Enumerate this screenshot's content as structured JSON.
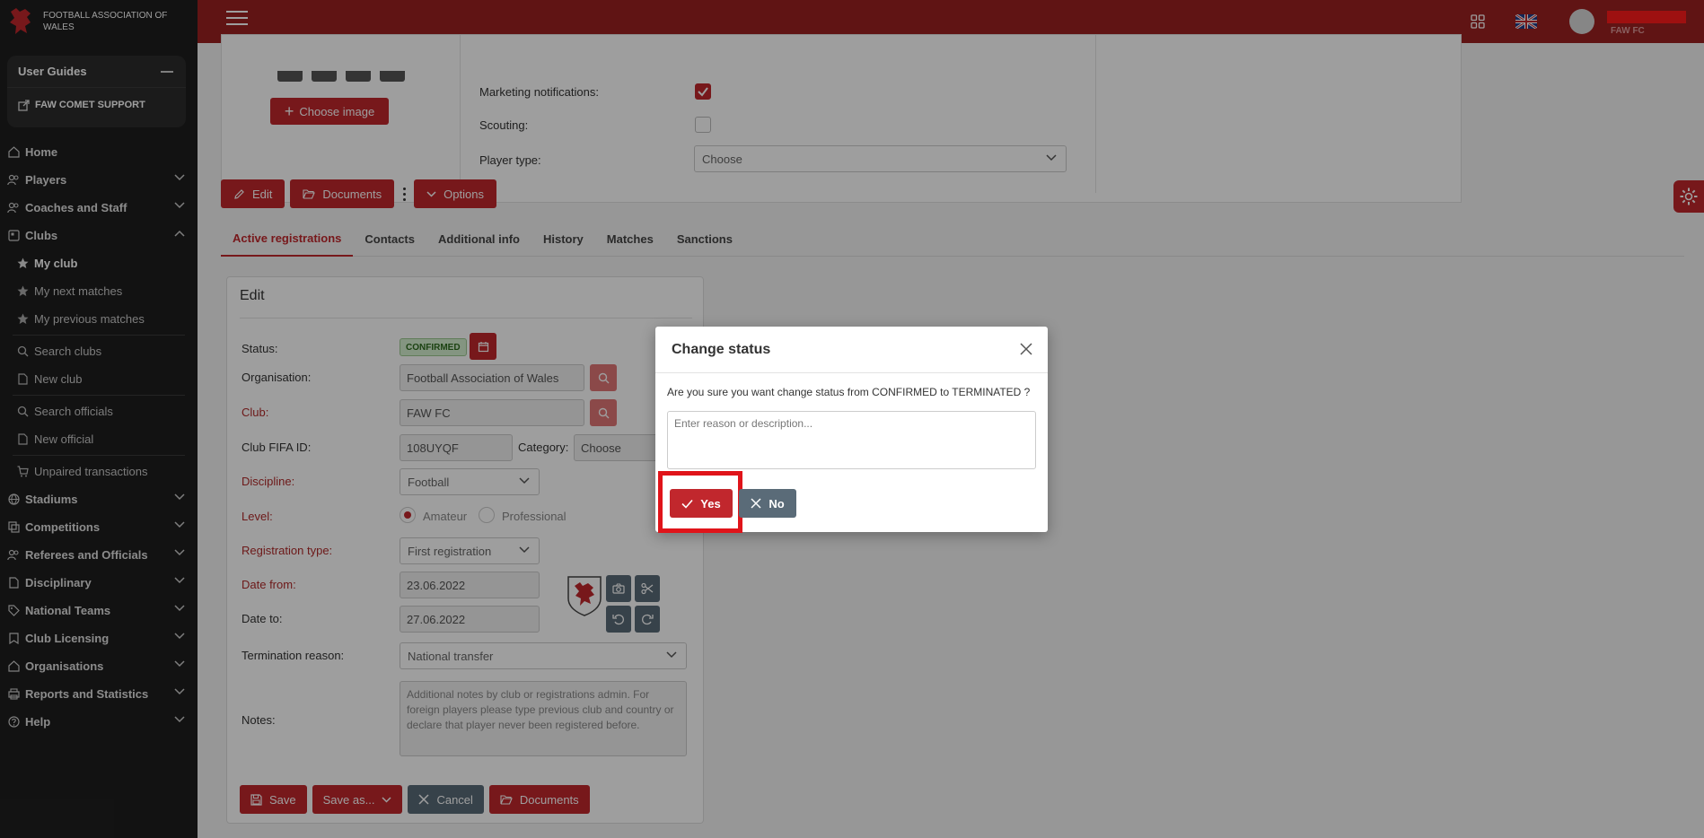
{
  "brand": {
    "name": "FOOTBALL ASSOCIATION OF WALES"
  },
  "user_guides": {
    "title": "User Guides",
    "support": "FAW COMET SUPPORT"
  },
  "nav": {
    "home": "Home",
    "players": "Players",
    "coaches": "Coaches and Staff",
    "clubs": "Clubs",
    "my_club": "My club",
    "next_matches": "My next matches",
    "prev_matches": "My previous matches",
    "search_clubs": "Search clubs",
    "new_club": "New club",
    "search_officials": "Search officials",
    "new_official": "New official",
    "unpaired": "Unpaired transactions",
    "stadiums": "Stadiums",
    "competitions": "Competitions",
    "referees": "Referees and Officials",
    "disciplinary": "Disciplinary",
    "national_teams": "National Teams",
    "club_licensing": "Club Licensing",
    "organisations": "Organisations",
    "reports": "Reports and Statistics",
    "help": "Help"
  },
  "topbar": {
    "user_club": "FAW FC"
  },
  "profile": {
    "choose_image": "Choose image",
    "marketing_label": "Marketing notifications:",
    "scouting_label": "Scouting:",
    "player_type_label": "Player type:",
    "player_type_value": "Choose"
  },
  "actions": {
    "edit": "Edit",
    "documents": "Documents",
    "options": "Options"
  },
  "tabs": [
    "Active registrations",
    "Contacts",
    "Additional info",
    "History",
    "Matches",
    "Sanctions"
  ],
  "edit_form": {
    "title": "Edit",
    "status_label": "Status:",
    "status_value": "CONFIRMED",
    "organisation_label": "Organisation:",
    "organisation_value": "Football Association of Wales",
    "club_label": "Club:",
    "club_value": "FAW FC",
    "fifa_label": "Club FIFA ID:",
    "fifa_value": "108UYQF",
    "category_label": "Category:",
    "category_value": "Choose",
    "discipline_label": "Discipline:",
    "discipline_value": "Football",
    "level_label": "Level:",
    "level_amateur": "Amateur",
    "level_professional": "Professional",
    "reg_type_label": "Registration type:",
    "reg_type_value": "First registration",
    "date_from_label": "Date from:",
    "date_from_value": "23.06.2022",
    "date_to_label": "Date to:",
    "date_to_value": "27.06.2022",
    "termination_label": "Termination reason:",
    "termination_value": "National transfer",
    "notes_label": "Notes:",
    "notes_placeholder": "Additional notes by club or registrations admin. For foreign players please type previous club and country or declare that player never been registered before.",
    "save": "Save",
    "save_as": "Save as...",
    "cancel": "Cancel",
    "documents": "Documents"
  },
  "modal": {
    "title": "Change status",
    "message": "Are you sure you want change status from CONFIRMED to TERMINATED ?",
    "placeholder": "Enter reason or description...",
    "yes": "Yes",
    "no": "No"
  },
  "colors": {
    "brand_red": "#9c2121",
    "button_red": "#c1272d",
    "slate": "#5a6b78",
    "highlight": "#e0141a"
  }
}
